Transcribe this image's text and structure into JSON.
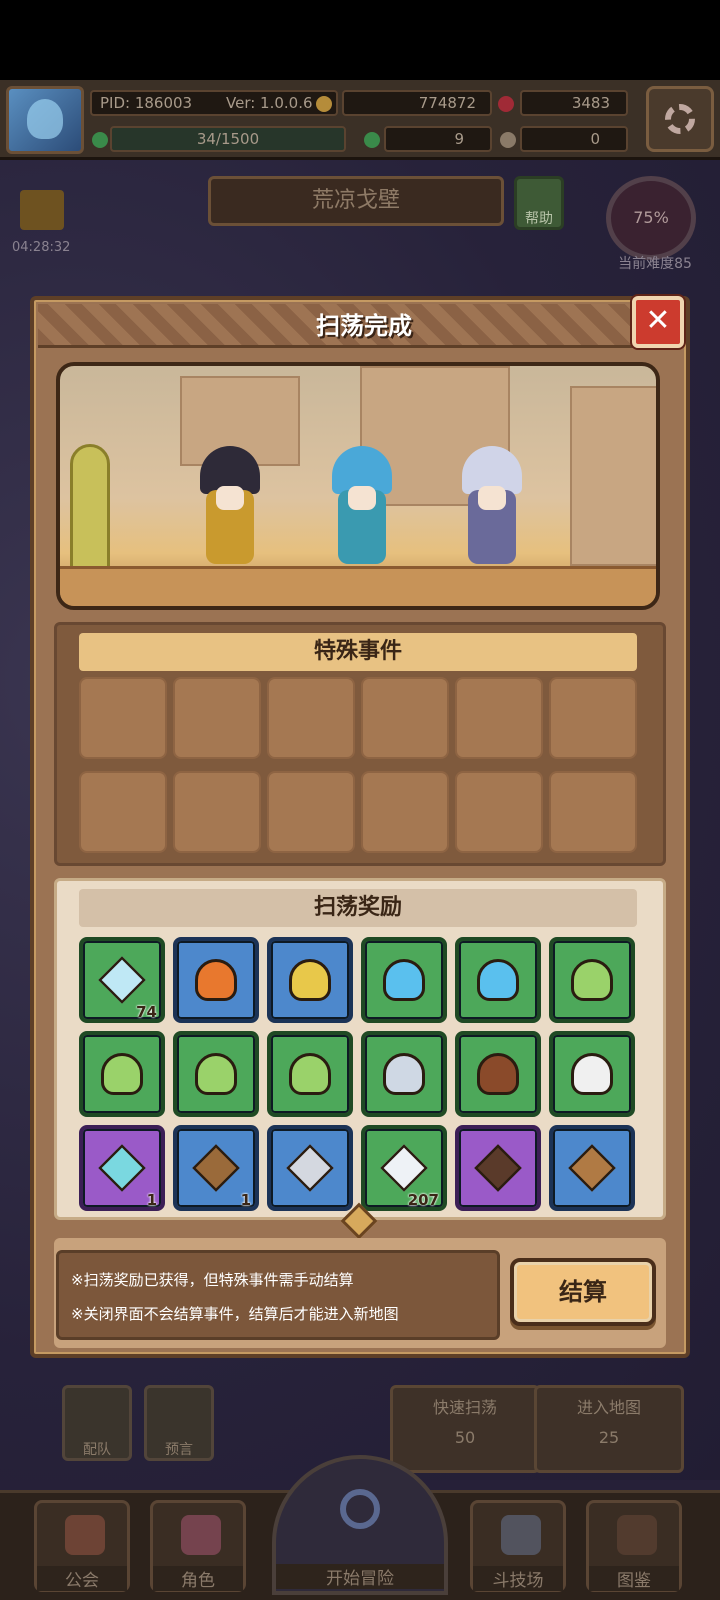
{
  "hud": {
    "pid": "PID: 186003",
    "version": "Ver: 1.0.0.6",
    "gold": "774872",
    "gems": "3483",
    "stamina": "34/1500",
    "clover": "9",
    "keys": "0"
  },
  "gift": {
    "timer": "04:28:32"
  },
  "region": {
    "name": "荒凉戈壁",
    "help_label": "帮助"
  },
  "difficulty": {
    "percent": "75%",
    "label": "当前难度85"
  },
  "modal": {
    "title": "扫荡完成",
    "close_glyph": "✕",
    "events_title": "特殊事件",
    "rewards_title": "扫荡奖励",
    "rewards": [
      {
        "icon": "crystal-shard-icon",
        "color": "green",
        "qty": "74"
      },
      {
        "icon": "orange-sleeping-slime-icon",
        "color": "blue",
        "qty": ""
      },
      {
        "icon": "yellow-slime-icon",
        "color": "blue",
        "qty": ""
      },
      {
        "icon": "blue-slime-icon",
        "color": "green",
        "qty": ""
      },
      {
        "icon": "blue-slime-icon",
        "color": "green",
        "qty": ""
      },
      {
        "icon": "green-slime-icon",
        "color": "green",
        "qty": ""
      },
      {
        "icon": "green-slime-icon",
        "color": "green",
        "qty": ""
      },
      {
        "icon": "green-slime-icon",
        "color": "green",
        "qty": ""
      },
      {
        "icon": "green-slime-icon",
        "color": "green",
        "qty": ""
      },
      {
        "icon": "knight-helmet-slime-icon",
        "color": "green",
        "qty": ""
      },
      {
        "icon": "pirate-hat-slime-icon",
        "color": "green",
        "qty": ""
      },
      {
        "icon": "white-hood-slime-icon",
        "color": "green",
        "qty": ""
      },
      {
        "icon": "ice-crystal-cluster-icon",
        "color": "purple",
        "qty": "1"
      },
      {
        "icon": "wood-log-icon",
        "color": "blue",
        "qty": "1"
      },
      {
        "icon": "silver-ingot-icon",
        "color": "blue",
        "qty": ""
      },
      {
        "icon": "diamond-gem-icon",
        "color": "green",
        "qty": "207"
      },
      {
        "icon": "arrow-quiver-icon",
        "color": "purple",
        "qty": ""
      },
      {
        "icon": "leather-boots-icon",
        "color": "blue",
        "qty": ""
      }
    ],
    "notes": [
      "※扫荡奖励已获得，但特殊事件需手动结算",
      "※关闭界面不会结算事件，结算后才能进入新地图"
    ],
    "settle_label": "结算"
  },
  "actions": {
    "team_label": "配队",
    "prophecy_label": "预言",
    "quick_sweep_label": "快速扫荡",
    "quick_sweep_cost": "50",
    "enter_map_label": "进入地图",
    "enter_map_cost": "25"
  },
  "nav": {
    "guild": "公会",
    "character": "角色",
    "adventure": "开始冒险",
    "arena": "斗技场",
    "codex": "图鉴"
  },
  "colors": {
    "item_green": "#4da85a",
    "item_blue": "#4d88cc",
    "item_purple": "#9a5ac8",
    "close_red": "#cc3b2e",
    "settle_gold": "#f1c27e"
  }
}
